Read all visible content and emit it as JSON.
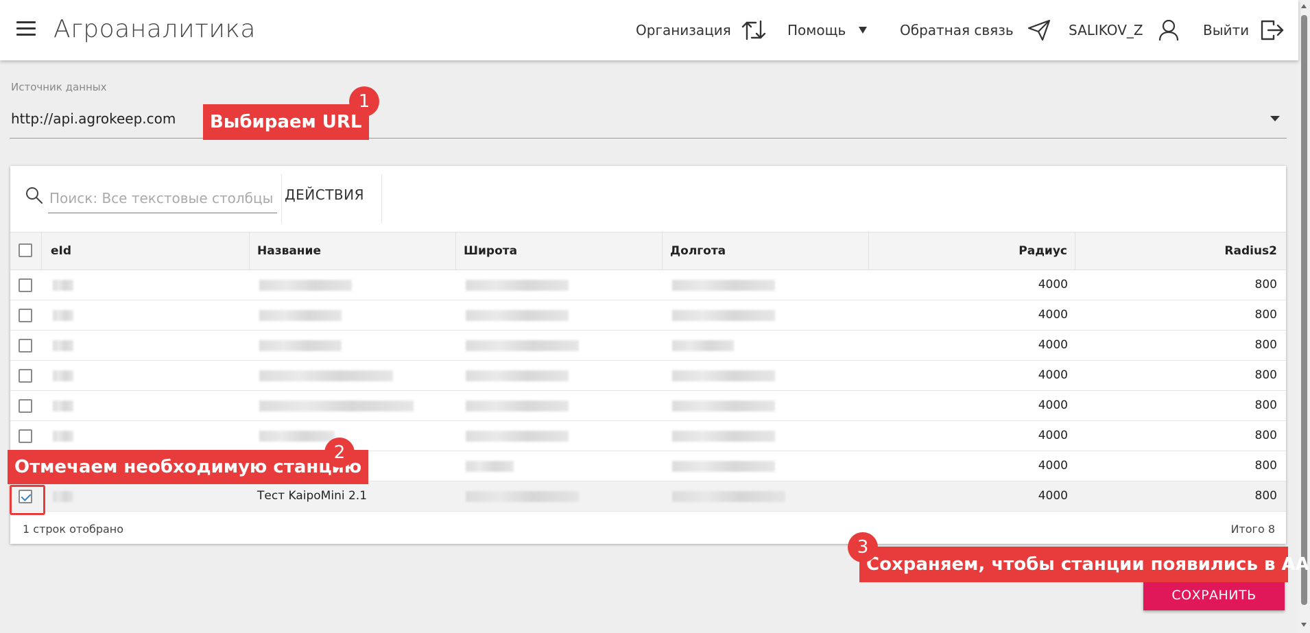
{
  "header": {
    "app_title": "Агроаналитика",
    "nav": {
      "organization": "Организация",
      "help": "Помощь",
      "feedback": "Обратная связь",
      "user": "SALIKOV_Z",
      "logout": "Выйти"
    }
  },
  "datasource": {
    "label": "Источник данных",
    "value": "http://api.agrokeep.com"
  },
  "grid": {
    "search_placeholder": "Поиск: Все текстовые столбцы",
    "actions_label": "ДЕЙСТВИЯ",
    "columns": [
      "eId",
      "Название",
      "Широта",
      "Долгота",
      "Радиус",
      "Radius2"
    ],
    "rows": [
      {
        "name": "",
        "radius": "4000",
        "radius2": "800",
        "checked": false
      },
      {
        "name": "",
        "radius": "4000",
        "radius2": "800",
        "checked": false
      },
      {
        "name": "",
        "radius": "4000",
        "radius2": "800",
        "checked": false
      },
      {
        "name": "",
        "radius": "4000",
        "radius2": "800",
        "checked": false
      },
      {
        "name": "",
        "radius": "4000",
        "radius2": "800",
        "checked": false
      },
      {
        "name": "",
        "radius": "4000",
        "radius2": "800",
        "checked": false
      },
      {
        "name": "",
        "radius": "4000",
        "radius2": "800",
        "checked": false
      },
      {
        "name": "Тест KaipoMini 2.1",
        "radius": "4000",
        "radius2": "800",
        "checked": true
      }
    ],
    "footer_selected": "1 строк отобрано",
    "footer_total": "Итого 8"
  },
  "save_label": "СОХРАНИТЬ",
  "annotations": {
    "step1": {
      "number": "1",
      "text": "Выбираем URL"
    },
    "step2": {
      "number": "2",
      "text": "Отмечаем необходимую станцию"
    },
    "step3": {
      "number": "3",
      "text": "Сохраняем, чтобы станции появились в АА"
    }
  },
  "colors": {
    "accent": "#e0185a",
    "annotation": "#e83c3c",
    "checkmark": "#3a7fb8"
  }
}
